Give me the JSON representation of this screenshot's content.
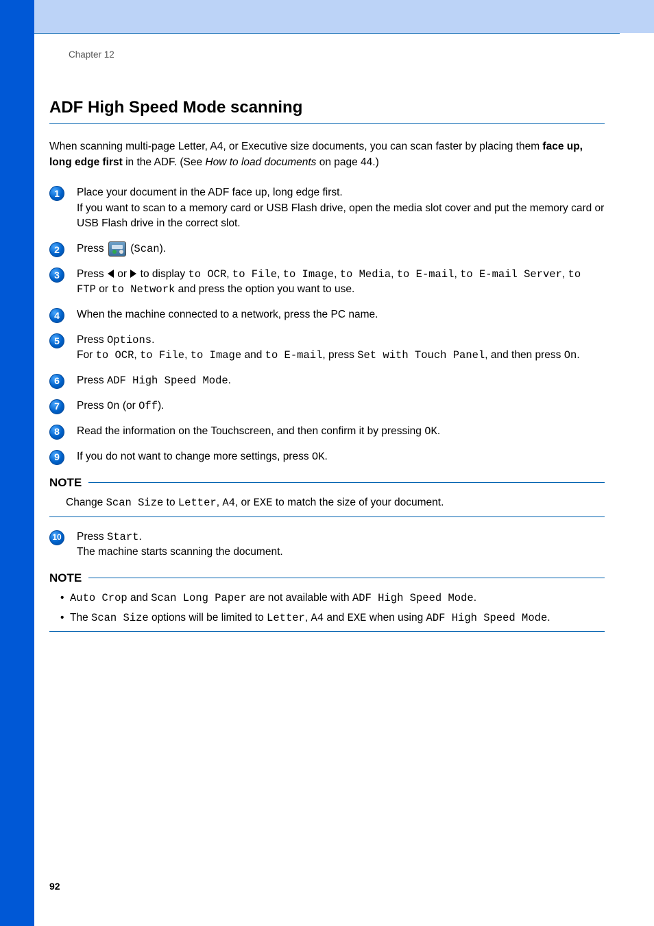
{
  "chapter": "Chapter 12",
  "title": "ADF High Speed Mode scanning",
  "intro": {
    "pre": "When scanning multi-page Letter, A4, or Executive size documents, you can scan faster by placing them ",
    "bold": "face up, long edge first",
    "mid": " in the ADF. (See ",
    "link": "How to load documents",
    "post": " on page 44.)"
  },
  "steps": {
    "s1": {
      "l1": "Place your document in the ADF face up, long edge first.",
      "l2": "If you want to scan to a memory card or USB Flash drive, open the media slot cover and put the memory card or USB Flash drive in the correct slot."
    },
    "s2": {
      "pre": "Press ",
      "paren_open": " (",
      "code": "Scan",
      "paren_close": ")."
    },
    "s3": {
      "pre": "Press ",
      "mid1": " or ",
      "mid2": " to display ",
      "opt1": "to OCR",
      "c1": ", ",
      "opt2": "to File",
      "c2": ", ",
      "opt3": "to Image",
      "c3": ", ",
      "opt4": "to Media",
      "c4": ", ",
      "opt5": "to E-mail",
      "c5": ", ",
      "opt6": "to E-mail Server",
      "c6": ", ",
      "opt7": "to FTP",
      "or": " or ",
      "opt8": "to Network",
      "post": " and press the option you want to use."
    },
    "s4": "When the machine connected to a network, press the PC name.",
    "s5": {
      "l1_pre": "Press ",
      "l1_code": "Options",
      "l1_post": ".",
      "l2_pre": "For ",
      "a": "to OCR",
      "ca": ", ",
      "b": "to File",
      "cb": ", ",
      "c": "to Image",
      "and1": " and ",
      "d": "to E-mail",
      "mid": ", press ",
      "e": "Set with Touch Panel",
      "post1": ", and then press ",
      "f": "On",
      "dot": "."
    },
    "s6": {
      "pre": "Press ",
      "code": "ADF High Speed Mode",
      "post": "."
    },
    "s7": {
      "pre": "Press ",
      "on": "On",
      "mid": " (or ",
      "off": "Off",
      "post": ")."
    },
    "s8": {
      "pre": "Read the information on the Touchscreen, and then confirm it by pressing ",
      "code": "OK",
      "post": "."
    },
    "s9": {
      "pre": "If you do not want to change more settings, press ",
      "code": "OK",
      "post": "."
    },
    "s10": {
      "l1_pre": "Press ",
      "l1_code": "Start",
      "l1_post": ".",
      "l2": "The machine starts scanning the document."
    }
  },
  "note1": {
    "label": "NOTE",
    "pre": "Change ",
    "a": "Scan Size",
    "mid1": " to ",
    "b": "Letter",
    "c1": ", ",
    "c": "A4",
    "c2": ", or ",
    "d": "EXE",
    "post": " to match the size of your document."
  },
  "note2": {
    "label": "NOTE",
    "b1": {
      "a": "Auto Crop",
      "mid1": " and ",
      "b": "Scan Long Paper",
      "mid2": " are not available with ",
      "c": "ADF High Speed Mode",
      "post": "."
    },
    "b2": {
      "pre": "The ",
      "a": "Scan Size",
      "mid1": " options will be limited to ",
      "b": "Letter",
      "c1": ", ",
      "c": "A4",
      "mid2": " and ",
      "d": "EXE",
      "mid3": " when using ",
      "e": "ADF High Speed Mode",
      "post": "."
    }
  },
  "page_number": "92"
}
